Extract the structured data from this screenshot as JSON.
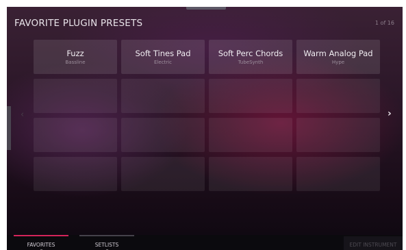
{
  "header": {
    "title": "FAVORITE PLUGIN PRESETS",
    "page_indicator": "1 of 16"
  },
  "presets": [
    {
      "name": "Fuzz",
      "category": "Bassline"
    },
    {
      "name": "Soft Tines Pad",
      "category": "Electric"
    },
    {
      "name": "Soft Perc Chords",
      "category": "TubeSynth"
    },
    {
      "name": "Warm Analog Pad",
      "category": "Hype"
    }
  ],
  "navigation": {
    "prev_icon": "chevron-left-icon",
    "next_icon": "chevron-right-icon"
  },
  "footer": {
    "tabs": [
      {
        "label": "FAVORITES",
        "active": true
      },
      {
        "label": "SETLISTS",
        "active": false
      }
    ],
    "edit_instrument_label": "EDIT INSTRUMENT"
  },
  "colors": {
    "active_tab_accent": "#d4245a"
  }
}
